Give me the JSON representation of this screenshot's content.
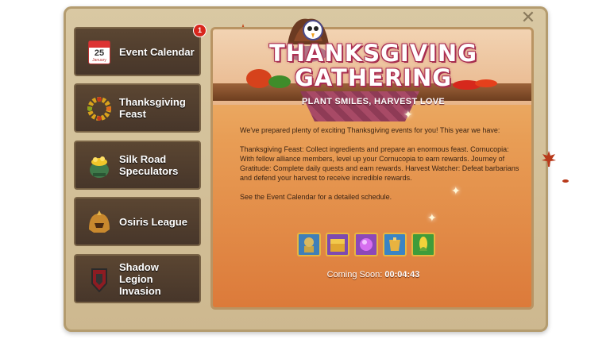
{
  "close_label": "✕",
  "sidebar": {
    "items": [
      {
        "label": "Event Calendar",
        "icon": "calendar-icon",
        "badge": "1",
        "cal_day": "25",
        "cal_month": "January"
      },
      {
        "label": "Thanksgiving Feast",
        "icon": "wreath-icon"
      },
      {
        "label": "Silk Road Speculators",
        "icon": "treasure-pot-icon"
      },
      {
        "label": "Osiris League",
        "icon": "helmet-icon"
      },
      {
        "label": "Shadow Legion Invasion",
        "icon": "shield-banner-icon"
      }
    ]
  },
  "event": {
    "title_line1": "THANKSGIVING",
    "title_line2": "GATHERING",
    "subtitle": "PLANT SMILES, HARVEST LOVE",
    "intro": "We've prepared plenty of exciting Thanksgiving events for you! This year we have:",
    "details": "Thanksgiving Feast: Collect ingredients and prepare an enormous feast. Cornucopia: With fellow alliance members, level up your Cornucopia to earn rewards. Journey of Gratitude: Complete daily quests and earn rewards. Harvest Watcher: Defeat barbarians and defend your harvest to receive incredible rewards.",
    "see_calendar": "See the Event Calendar for a detailed schedule.",
    "coming_label": "Coming Soon:",
    "timer": "00:04:43"
  },
  "rewards": [
    {
      "icon": "commander-sculpture-icon",
      "color": "#3f7fb8"
    },
    {
      "icon": "gold-chest-icon",
      "color": "#7d4ab0"
    },
    {
      "icon": "purple-orb-icon",
      "color": "#8c48b8"
    },
    {
      "icon": "golden-armor-icon",
      "color": "#3a84c4"
    },
    {
      "icon": "corn-icon",
      "color": "#3f9c3a"
    }
  ],
  "colors": {
    "accent": "#e7b640",
    "title_stroke": "#a12c4c",
    "badge": "#d8261c",
    "sidebar_bg": "#4f3d2e"
  }
}
